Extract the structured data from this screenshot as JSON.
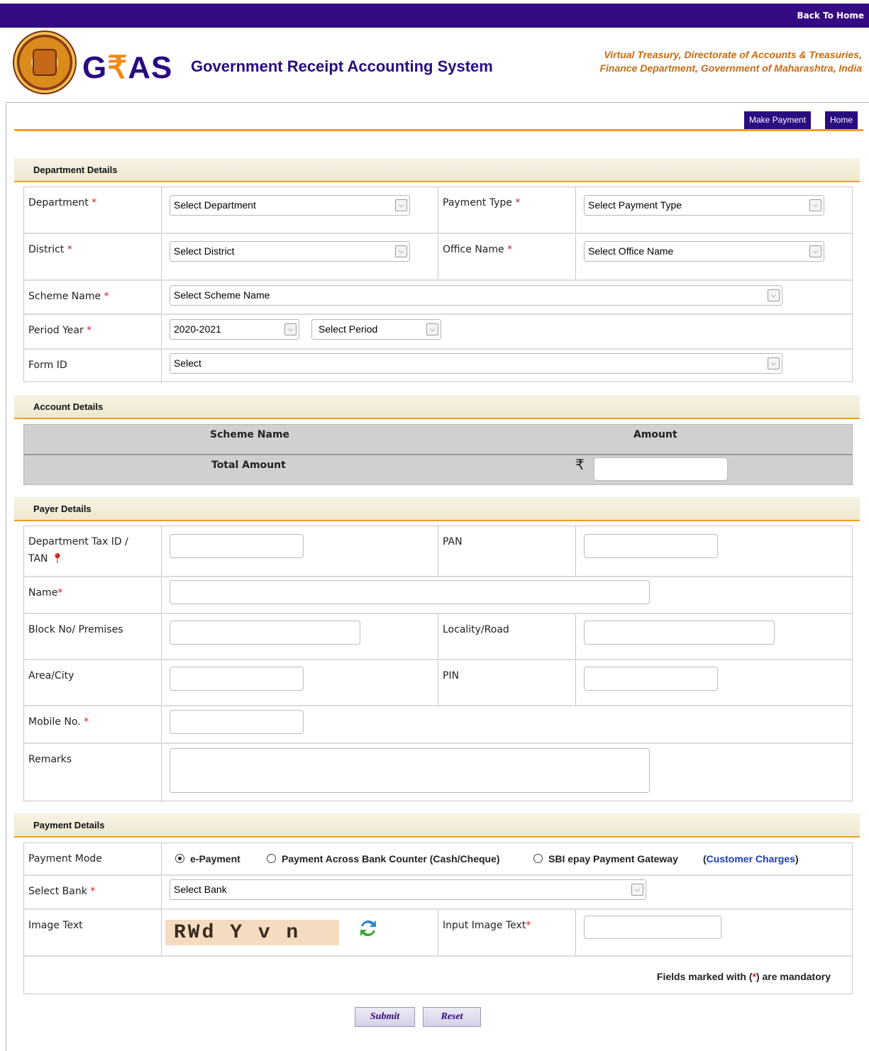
{
  "top_bar": {
    "back_to_home": "Back To Home"
  },
  "brand": {
    "name_g": "G",
    "name_dev": "₹",
    "name_as": "AS",
    "full": "Government Receipt Accounting System",
    "tagline_1": "Virtual Treasury, Directorate of Accounts & Treasuries,",
    "tagline_2": "Finance Department, Government of Maharashtra, India"
  },
  "nav": {
    "make_payment": "Make Payment",
    "home": "Home"
  },
  "department_details": {
    "title": "Department Details",
    "department_label": "Department",
    "department_value": "Select Department",
    "payment_type_label": "Payment Type",
    "payment_type_value": "Select Payment Type",
    "district_label": "District",
    "district_value": "Select District",
    "office_name_label": "Office Name",
    "office_name_value": "Select Office Name",
    "scheme_name_label": "Scheme Name",
    "scheme_name_value": "Select Scheme Name",
    "period_year_label": "Period Year",
    "period_year_value": "2020-2021",
    "period_value": "Select Period",
    "form_id_label": "Form ID",
    "form_id_value": "Select"
  },
  "account_details": {
    "title": "Account Details",
    "col_scheme": "Scheme Name",
    "col_amount": "Amount",
    "total_label": "Total Amount",
    "currency": "₹"
  },
  "payer_details": {
    "title": "Payer Details",
    "tax_id_label_1": "Department Tax ID /",
    "tax_id_label_2": "TAN",
    "pan_label": "PAN",
    "name_label": "Name",
    "block_label": "Block No/ Premises",
    "locality_label": "Locality/Road",
    "area_label": "Area/City",
    "pin_label": "PIN",
    "mobile_label": "Mobile No.",
    "remarks_label": "Remarks"
  },
  "payment_details": {
    "title": "Payment Details",
    "mode_label": "Payment Mode",
    "mode_options": [
      "e-Payment",
      "Payment Across Bank Counter (Cash/Cheque)",
      "SBI epay Payment Gateway"
    ],
    "selected_mode": "e-Payment",
    "customer_charges": "Customer Charges",
    "paren_open": "(",
    "paren_close": ")",
    "bank_label": "Select Bank",
    "bank_value": "Select Bank",
    "image_text_label": "Image Text",
    "captcha": "RWd Y v n",
    "input_image_label": "Input Image Text",
    "mandatory_note_1": "Fields marked with (",
    "mandatory_star": "*",
    "mandatory_note_2": ") are mandatory"
  },
  "actions": {
    "submit": "Submit",
    "reset": "Reset"
  },
  "required_mark": "*",
  "colors": {
    "brand_purple": "#340b82",
    "accent_orange": "#f0a020",
    "required_red": "#d32020"
  }
}
